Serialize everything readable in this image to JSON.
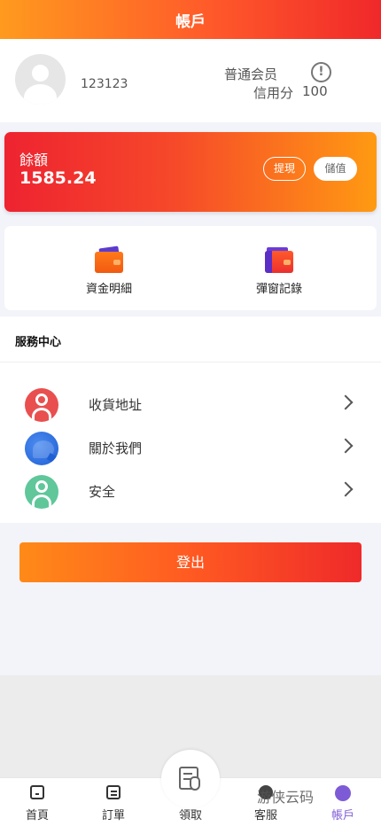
{
  "header": {
    "title": "帳戶"
  },
  "profile": {
    "username": "123123",
    "level": "普通会员",
    "info_icon": "!",
    "credit_label": "信用分",
    "credit_value": "100"
  },
  "balance": {
    "label": "餘額",
    "value": "1585.24",
    "withdraw_label": "提現",
    "deposit_label": "儲值"
  },
  "records": {
    "items": [
      {
        "label": "資金明細",
        "icon": "wallet-icon"
      },
      {
        "label": "彈窗記錄",
        "icon": "wallet-icon"
      }
    ]
  },
  "service": {
    "title": "服務中心",
    "items": [
      {
        "label": "收貨地址",
        "icon": "user-icon"
      },
      {
        "label": "關於我們",
        "icon": "chat-icon"
      },
      {
        "label": "安全",
        "icon": "user-icon"
      }
    ]
  },
  "logout": {
    "label": "登出"
  },
  "tabbar": {
    "items": [
      {
        "label": "首頁",
        "icon": "home-icon"
      },
      {
        "label": "訂單",
        "icon": "orders-icon"
      },
      {
        "label": "領取",
        "icon": "claim-icon"
      },
      {
        "label": "客服",
        "icon": "support-icon"
      },
      {
        "label": "帳戶",
        "icon": "account-icon"
      }
    ],
    "active_color": "#7e5bd6"
  },
  "watermark": "游侠云码",
  "colors": {
    "accent_orange": "#ff8a18",
    "accent_red": "#ef2a2a"
  }
}
